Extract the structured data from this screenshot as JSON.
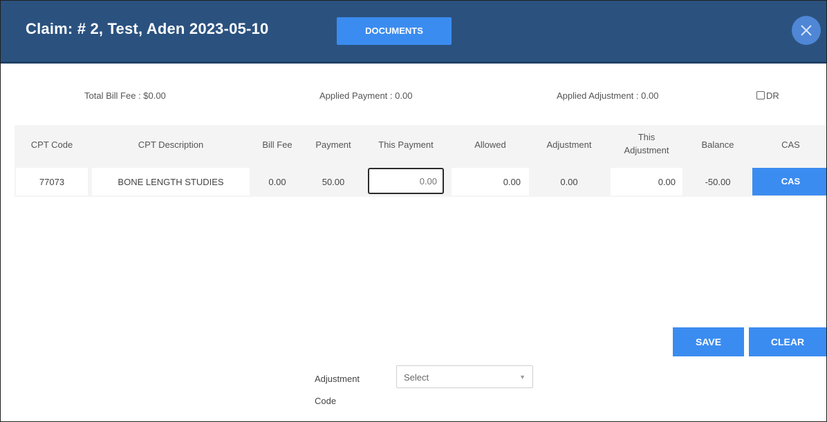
{
  "header": {
    "title": "Claim: # 2, Test, Aden 2023-05-10",
    "documents_label": "DOCUMENTS"
  },
  "summary": {
    "total_bill_fee": "Total Bill Fee : $0.00",
    "applied_payment": "Applied Payment : 0.00",
    "applied_adjustment": "Applied Adjustment : 0.00",
    "dr_label": "DR"
  },
  "table": {
    "headers": {
      "cpt_code": "CPT Code",
      "cpt_description": "CPT Description",
      "bill_fee": "Bill Fee",
      "payment": "Payment",
      "this_payment": "This Payment",
      "allowed": "Allowed",
      "adjustment": "Adjustment",
      "this_adjustment_line1": "This",
      "this_adjustment_line2": "Adjustment",
      "balance": "Balance",
      "cas": "CAS"
    },
    "rows": [
      {
        "cpt_code": "77073",
        "cpt_description": "BONE LENGTH STUDIES",
        "bill_fee": "0.00",
        "payment": "50.00",
        "this_payment_placeholder": "0.00",
        "allowed": "0.00",
        "adjustment": "0.00",
        "this_adjustment": "0.00",
        "balance": "-50.00",
        "cas_label": "CAS"
      }
    ]
  },
  "actions": {
    "save_label": "SAVE",
    "clear_label": "CLEAR"
  },
  "adjustment_code": {
    "label_line1": "Adjustment",
    "label_line2": "Code",
    "selected": "Select"
  },
  "colors": {
    "header_bg": "#2b527f",
    "accent_button": "#3b8cf0"
  },
  "icons": {
    "close": "close-icon",
    "dropdown": "chevron-down-icon",
    "checkbox": "checkbox-icon"
  }
}
